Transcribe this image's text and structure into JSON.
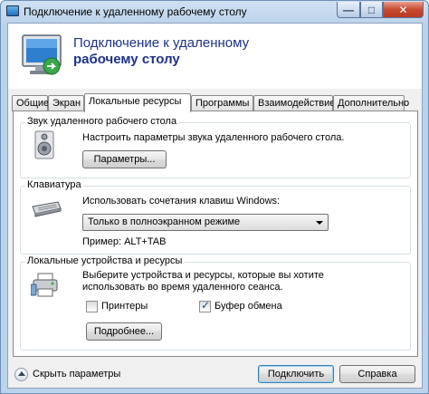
{
  "window": {
    "title": "Подключение к удаленному рабочему столу",
    "minimize_glyph": "—",
    "maximize_glyph": "□",
    "close_glyph": "✕"
  },
  "header": {
    "line1": "Подключение к удаленному",
    "line2": "рабочему столу",
    "icon": "remote-desktop-icon"
  },
  "tabs": [
    {
      "label": "Общие"
    },
    {
      "label": "Экран"
    },
    {
      "label": "Локальные ресурсы",
      "active": true
    },
    {
      "label": "Программы"
    },
    {
      "label": "Взаимодействие"
    },
    {
      "label": "Дополнительно"
    }
  ],
  "groups": {
    "sound": {
      "legend": "Звук удаленного рабочего стола",
      "description": "Настроить параметры звука удаленного рабочего стола.",
      "button": "Параметры...",
      "icon": "speaker-icon"
    },
    "keyboard": {
      "legend": "Клавиатура",
      "description": "Использовать сочетания клавиш Windows:",
      "selected_option": "Только в полноэкранном режиме",
      "example": "Пример: ALT+TAB",
      "icon": "keyboard-icon"
    },
    "devices": {
      "legend": "Локальные устройства и ресурсы",
      "description_line1": "Выберите устройства и ресурсы, которые вы хотите",
      "description_line2": "использовать во время удаленного сеанса.",
      "printers_label": "Принтеры",
      "printers_checked": false,
      "clipboard_label": "Буфер обмена",
      "clipboard_checked": true,
      "more_button": "Подробнее...",
      "icon": "devices-icon"
    }
  },
  "footer": {
    "hide_options": "Скрыть параметры",
    "connect_button": "Подключить",
    "help_button": "Справка"
  }
}
